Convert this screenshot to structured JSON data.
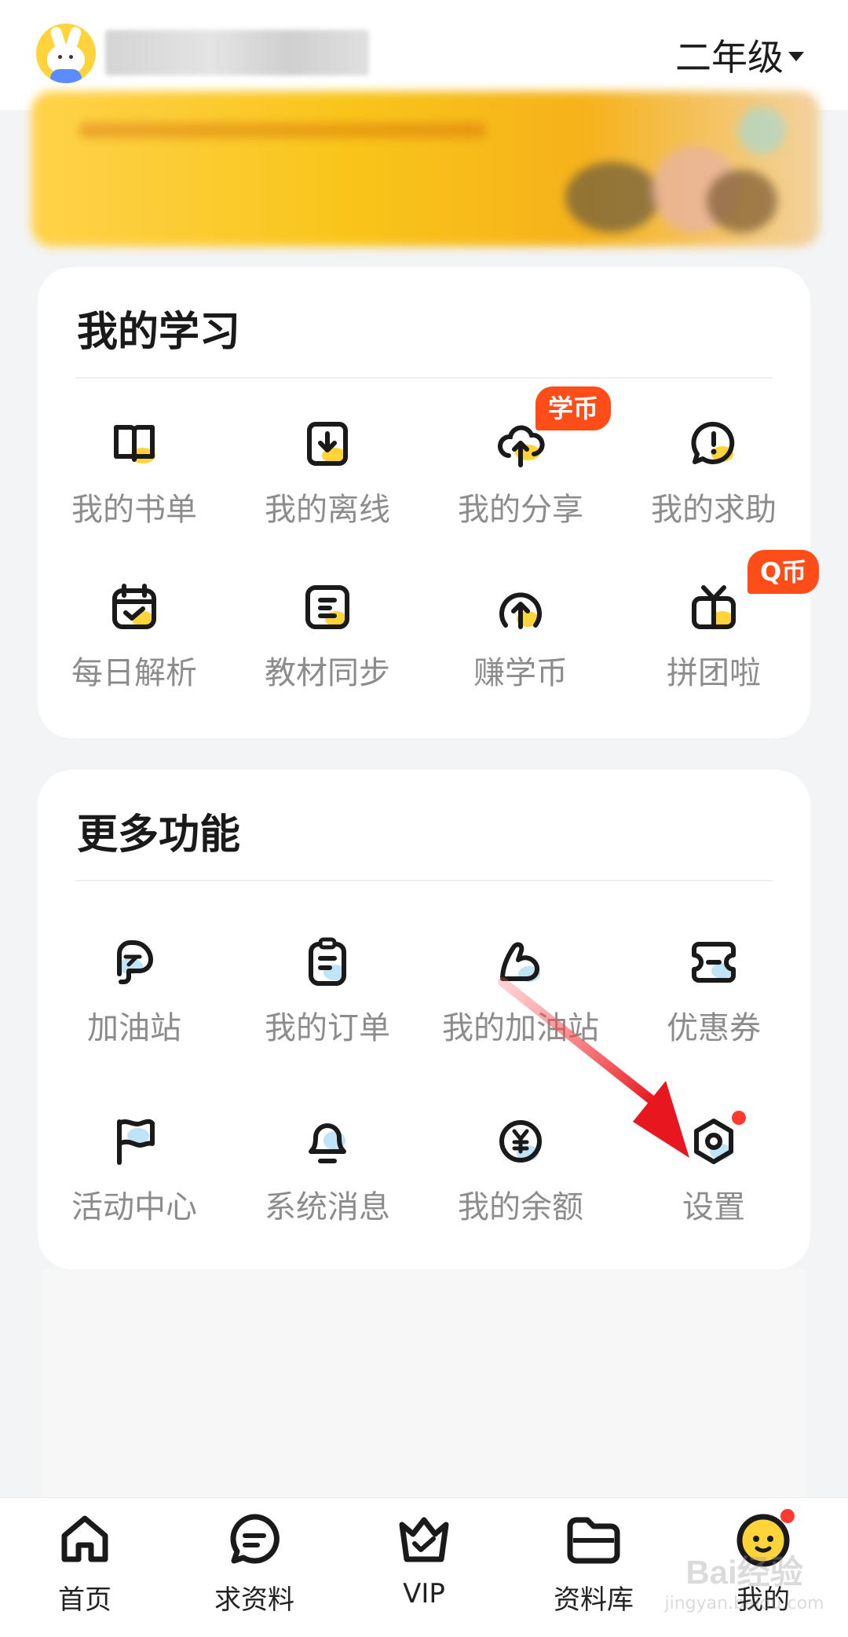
{
  "header": {
    "grade": "二年级"
  },
  "study": {
    "title": "我的学习",
    "items": [
      {
        "label": "我的书单",
        "icon": "book-icon"
      },
      {
        "label": "我的离线",
        "icon": "download-icon"
      },
      {
        "label": "我的分享",
        "icon": "cloud-upload-icon",
        "badge": "学币"
      },
      {
        "label": "我的求助",
        "icon": "help-bubble-icon"
      },
      {
        "label": "每日解析",
        "icon": "calendar-check-icon"
      },
      {
        "label": "教材同步",
        "icon": "textbook-icon"
      },
      {
        "label": "赚学币",
        "icon": "coin-up-icon"
      },
      {
        "label": "拼团啦",
        "icon": "gift-icon",
        "badge": "Q币"
      }
    ]
  },
  "more": {
    "title": "更多功能",
    "items": [
      {
        "label": "加油站",
        "icon": "fuel-station-icon"
      },
      {
        "label": "我的订单",
        "icon": "clipboard-icon"
      },
      {
        "label": "我的加油站",
        "icon": "flex-arm-icon"
      },
      {
        "label": "优惠券",
        "icon": "coupon-icon"
      },
      {
        "label": "活动中心",
        "icon": "flag-icon"
      },
      {
        "label": "系统消息",
        "icon": "bell-icon"
      },
      {
        "label": "我的余额",
        "icon": "yuan-icon"
      },
      {
        "label": "设置",
        "icon": "settings-icon"
      }
    ]
  },
  "nav": {
    "items": [
      {
        "label": "首页",
        "icon": "home-icon"
      },
      {
        "label": "求资料",
        "icon": "chat-icon"
      },
      {
        "label": "VIP",
        "icon": "crown-icon"
      },
      {
        "label": "资料库",
        "icon": "folder-icon"
      },
      {
        "label": "我的",
        "icon": "face-icon"
      }
    ]
  },
  "watermark": {
    "brand": "Bai",
    "sub": "经验",
    "url": "jingyan.baidu.com"
  },
  "colors": {
    "accent_yellow": "#ffd43b",
    "badge_red": "#ff4d1a",
    "icon_stroke": "#1a1a1a",
    "label_gray": "#8c8c8c",
    "arrow_red": "#e8161f"
  }
}
